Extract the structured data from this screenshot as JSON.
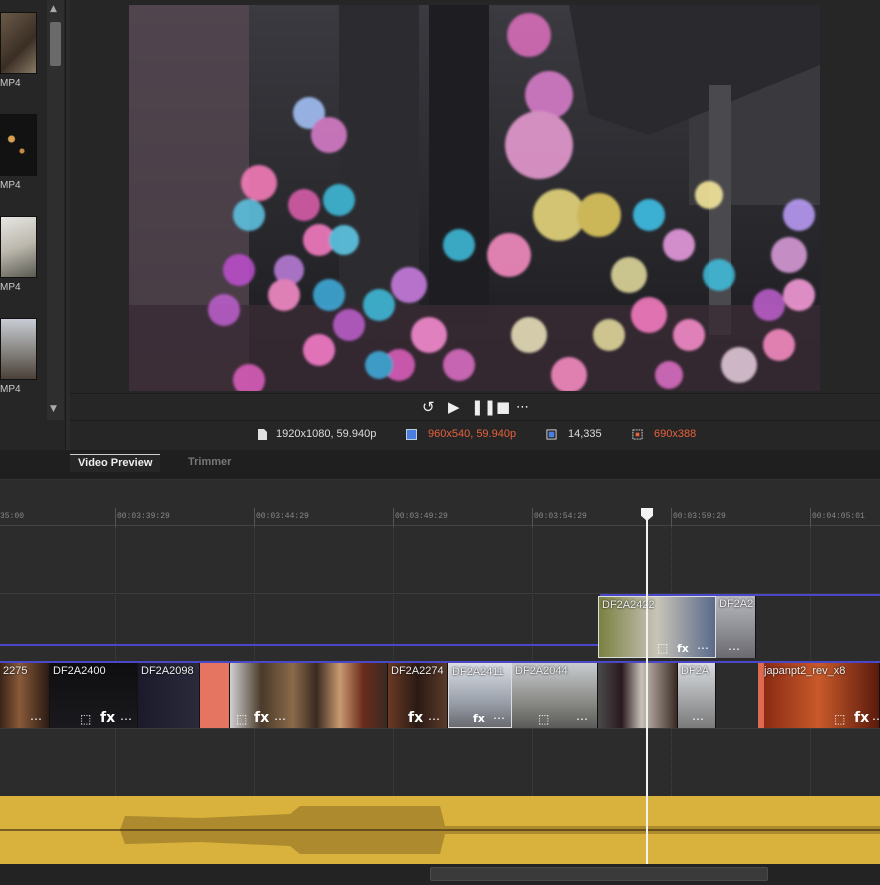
{
  "media_library": {
    "items": [
      {
        "label": "MP4"
      },
      {
        "label": "MP4"
      },
      {
        "label": "MP4"
      },
      {
        "label": "MP4"
      }
    ]
  },
  "player": {
    "loop_icon": "loop-icon",
    "play_icon": "play-icon",
    "pause_icon": "pause-icon",
    "stop_icon": "stop-icon",
    "more_icon": "more-icon",
    "more_label": "⋯"
  },
  "info": {
    "source": "1920x1080, 59.940p",
    "preview": "960x540, 59.940p",
    "frame": "14,335",
    "crop": "690x388",
    "colors": {
      "preview": "#e8603c",
      "crop": "#e8603c",
      "normal": "#dddddd"
    }
  },
  "tabs": [
    {
      "label": "Video Preview",
      "active": true
    },
    {
      "label": "Trimmer",
      "active": false
    }
  ],
  "ruler": {
    "ticks": [
      "35:00",
      "00:03:39:29",
      "00:03:44:29",
      "00:03:49:29",
      "00:03:54:29",
      "00:03:59:29",
      "00:04:05:01"
    ]
  },
  "track_top": {
    "clips": [
      {
        "label": "DF2A2422"
      },
      {
        "label": "DF2A2"
      }
    ]
  },
  "track_main": {
    "clips": [
      {
        "label": "2275"
      },
      {
        "label": "DF2A2400"
      },
      {
        "label": "DF2A2098"
      },
      {
        "label": ""
      },
      {
        "label": "DF2A2274"
      },
      {
        "label": "DF2A2411"
      },
      {
        "label": "DF2A2044"
      },
      {
        "label": ""
      },
      {
        "label": "DF2A"
      },
      {
        "label": "japanpt2_rev_x8"
      }
    ]
  },
  "clip_icons": {
    "crop": "⬚",
    "fx": "fx",
    "more": "⋯"
  }
}
